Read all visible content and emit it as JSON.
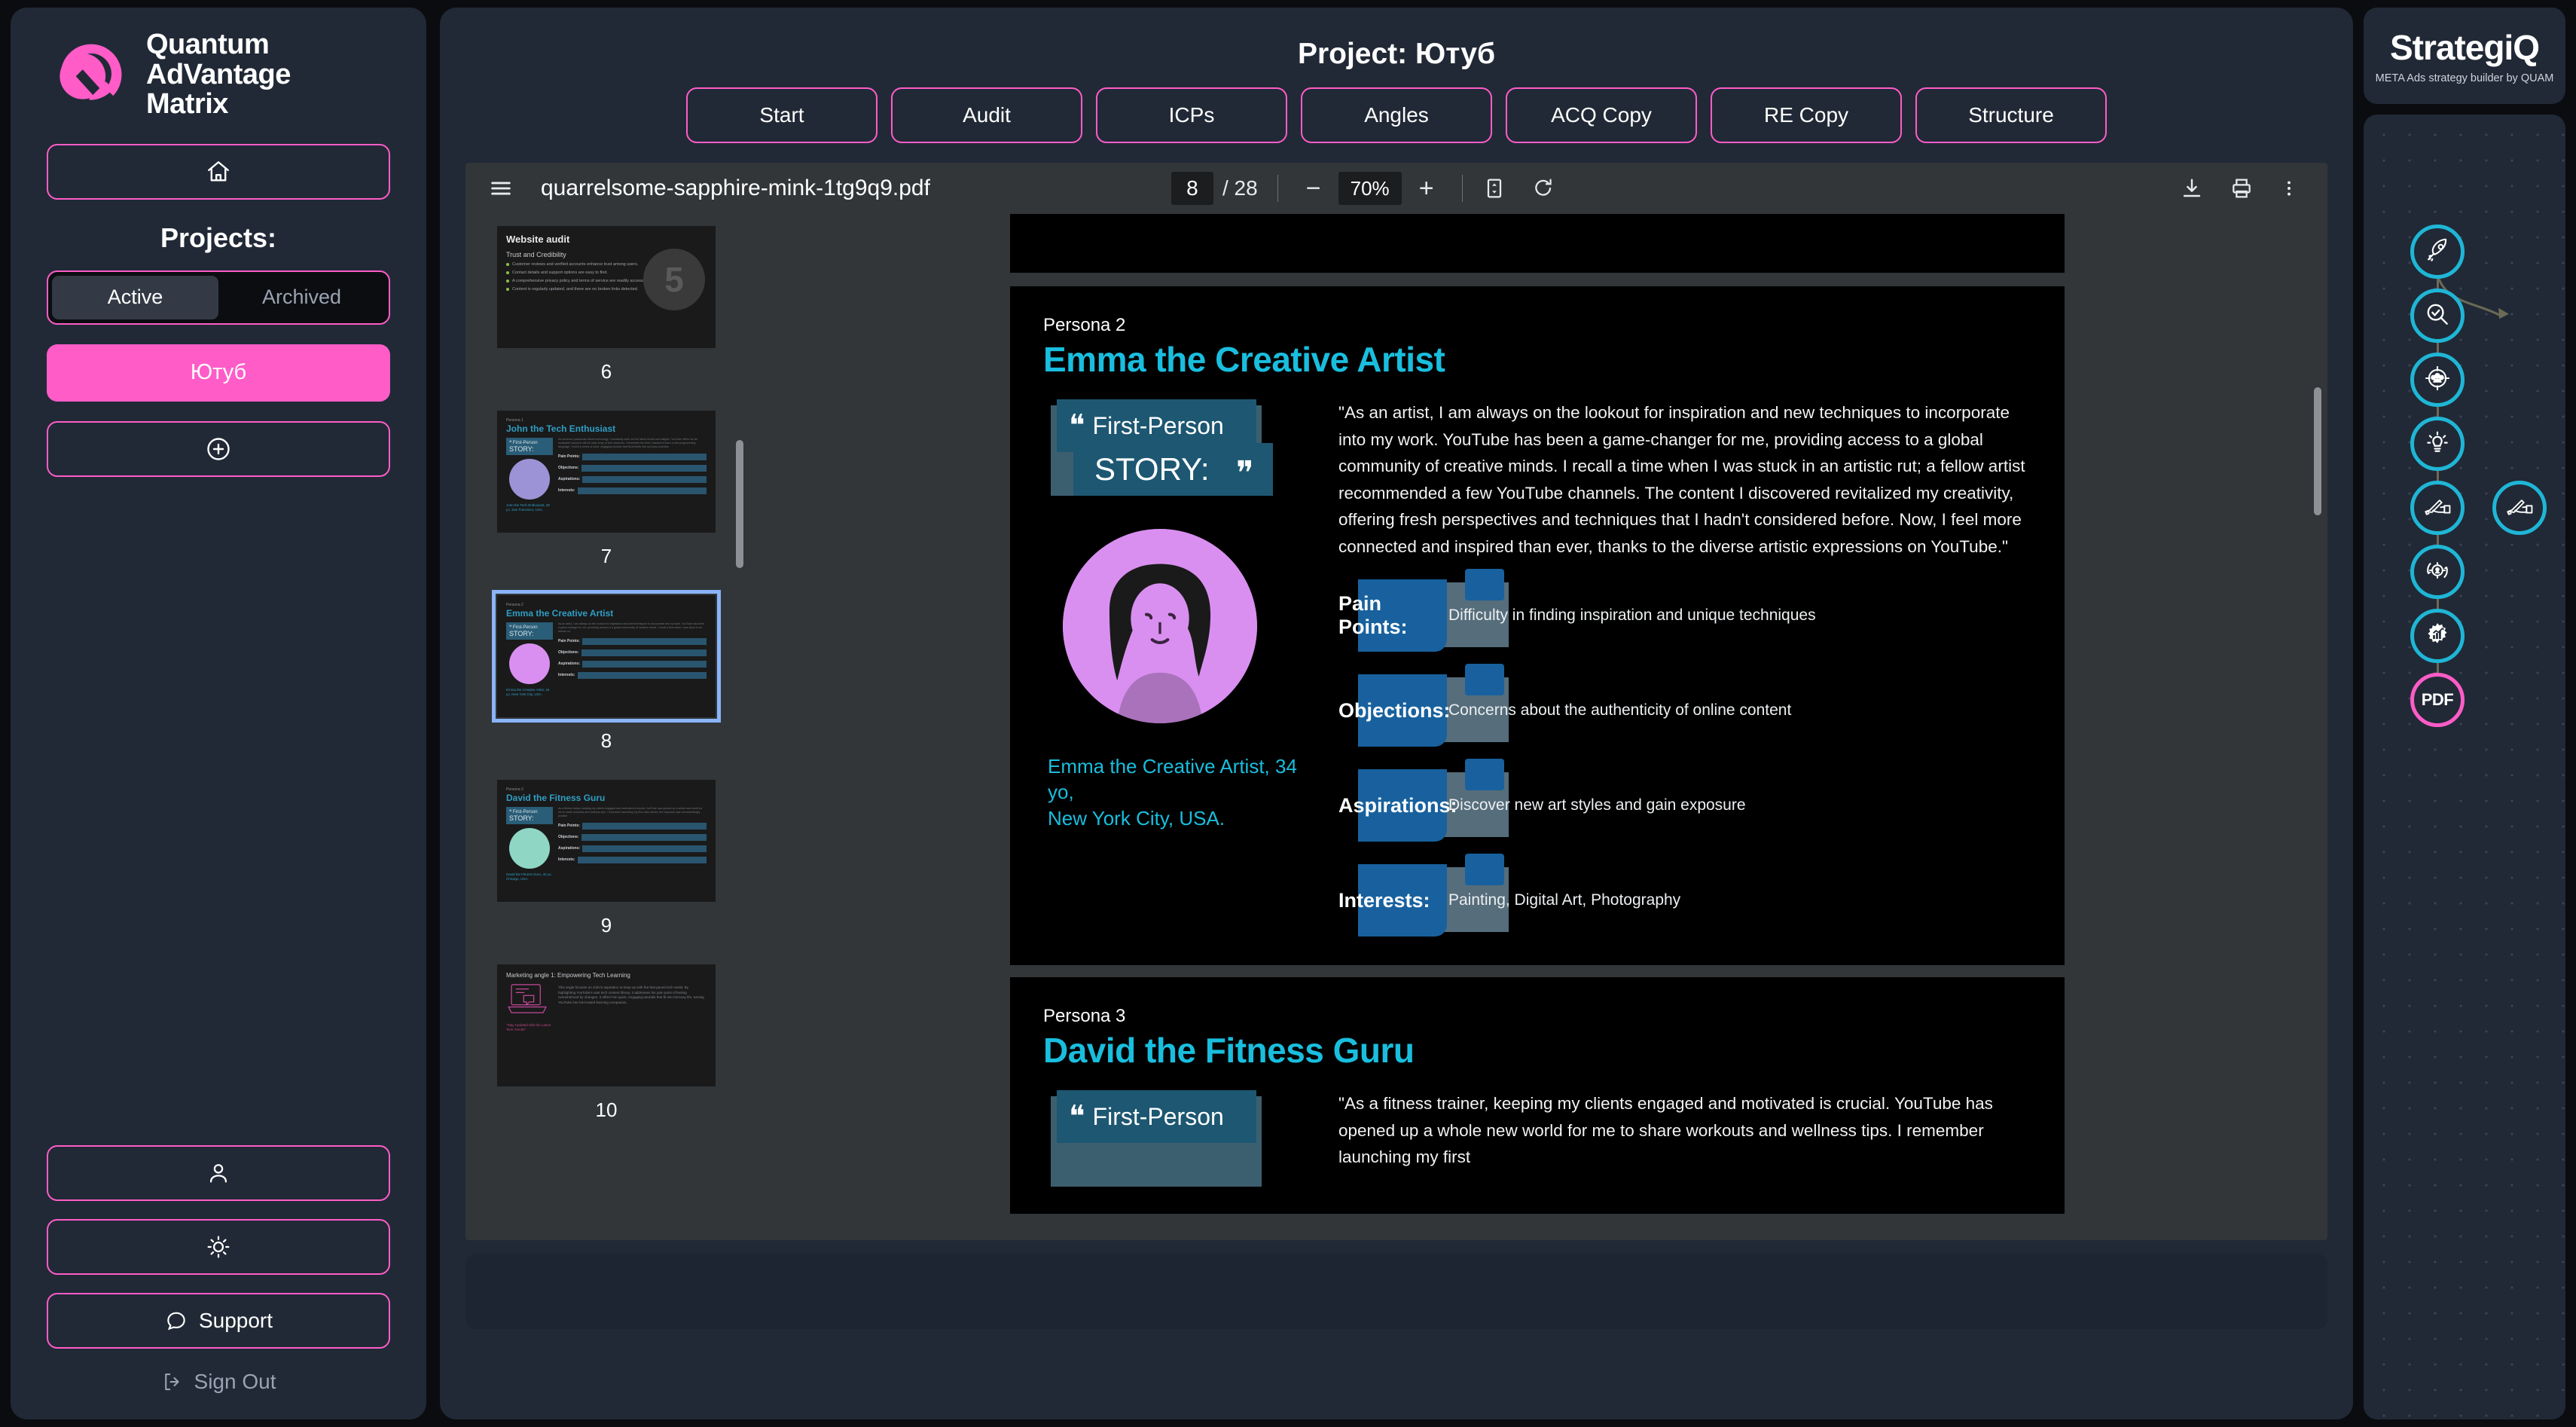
{
  "brand": {
    "name_line1": "Quantum",
    "name_line2": "AdVantage",
    "name_line3": "Matrix",
    "accent": "#ff5cc8"
  },
  "sidebar": {
    "home_icon": "home-icon",
    "projects_label": "Projects:",
    "filter": {
      "active": "Active",
      "archived": "Archived",
      "selected": "Active"
    },
    "projects": [
      {
        "label": "Ютуб",
        "selected": true
      }
    ],
    "add_project_icon": "plus-circle-icon",
    "account_icon": "user-icon",
    "theme_icon": "sun-icon",
    "support_label": "Support",
    "support_icon": "chat-bubble-icon",
    "signout_label": "Sign Out",
    "signout_icon": "logout-icon"
  },
  "center": {
    "project_title": "Project: Ютуб",
    "tabs": [
      {
        "label": "Start"
      },
      {
        "label": "Audit"
      },
      {
        "label": "ICPs"
      },
      {
        "label": "Angles"
      },
      {
        "label": "ACQ Copy"
      },
      {
        "label": "RE Copy"
      },
      {
        "label": "Structure"
      }
    ]
  },
  "pdf_toolbar": {
    "menu_icon": "hamburger-menu-icon",
    "filename": "quarrelsome-sapphire-mink-1tg9q9.pdf",
    "page_current": "8",
    "page_total": "/ 28",
    "zoom_out_icon": "minus-icon",
    "zoom_level": "70%",
    "zoom_in_icon": "plus-icon",
    "fit_icon": "fit-page-icon",
    "rotate_icon": "rotate-icon",
    "download_icon": "download-icon",
    "print_icon": "print-icon",
    "more_icon": "more-vertical-icon"
  },
  "thumbnails": [
    {
      "number": "6",
      "kind": "audit",
      "title": "Website audit",
      "subtitle": "Trust and Credibility",
      "badge": "5",
      "bullets": [
        "Customer reviews and verified accounts enhance trust among users.",
        "Contact details and support options are easy to find.",
        "A comprehensive privacy policy and terms of service are readily accessible.",
        "Content is regularly updated, and there are no broken links detected."
      ]
    },
    {
      "number": "7",
      "kind": "persona",
      "persona_label": "Persona 1",
      "persona_name": "John the Tech Enthusiast",
      "avatar_color": "#9b93d6",
      "caption": "John the Tech Enthusiast, 28 yo,\nSan Francisco, USA.",
      "fields": [
        "Pain Points:",
        "Objections:",
        "Aspirations:",
        "Interests:"
      ],
      "selected": false
    },
    {
      "number": "8",
      "kind": "persona",
      "persona_label": "Persona 2",
      "persona_name": "Emma the Creative Artist",
      "avatar_color": "#d98ff0",
      "caption": "Emma the Creative Artist, 34 yo,\nNew York City, USA.",
      "fields": [
        "Pain Points:",
        "Objections:",
        "Aspirations:",
        "Interests:"
      ],
      "selected": true
    },
    {
      "number": "9",
      "kind": "persona",
      "persona_label": "Persona 3",
      "persona_name": "David the Fitness Guru",
      "avatar_color": "#8fd6c5",
      "caption": "David the Fitness Guru, 40 yo,\nChicago, USA.",
      "fields": [
        "Pain Points:",
        "Objections:",
        "Aspirations:",
        "Interests:"
      ],
      "selected": false
    },
    {
      "number": "10",
      "kind": "angle",
      "title": "Marketing angle 1: Empowering Tech Learning",
      "body": "This angle focuses on John's aspiration to keep up with the fast-paced tech world. By highlighting YouTube's vast tech content library, it addresses his pain point of feeling overwhelmed by changes. It offers him quick, engaging tutorials that fit into his busy life, turning YouTube into his trusted learning companion.",
      "tagline": "\"Stay Updated with the Latest Tech Trends\""
    }
  ],
  "page": {
    "persona2": {
      "label": "Persona 2",
      "name": "Emma the Creative Artist",
      "quote_line1": "First-Person",
      "quote_line2": "STORY:",
      "story": "\"As an artist, I am always on the lookout for inspiration and new techniques to incorporate into my work. YouTube has been a game-changer for me, providing access to a global community of creative minds. I recall a time when I was stuck in an artistic rut; a fellow artist recommended a few YouTube channels. The content I discovered revitalized my creativity, offering fresh perspectives and techniques that I hadn't considered before. Now, I feel more connected and inspired than ever, thanks to the diverse artistic expressions on YouTube.\"",
      "caption_line1": "Emma the Creative Artist, 34 yo,",
      "caption_line2": "New York City, USA.",
      "fields": [
        {
          "label": "Pain Points:",
          "value": "Difficulty in finding inspiration and unique techniques"
        },
        {
          "label": "Objections:",
          "value": "Concerns about the authenticity of online content"
        },
        {
          "label": "Aspirations:",
          "value": "Discover new art styles and gain exposure"
        },
        {
          "label": "Interests:",
          "value": "Painting, Digital Art, Photography"
        }
      ]
    },
    "persona3": {
      "label": "Persona 3",
      "name": "David the Fitness Guru",
      "quote_line1": "First-Person",
      "story": "\"As a fitness trainer, keeping my clients engaged and motivated is crucial. YouTube has opened up a whole new world for me to share workouts and wellness tips. I remember launching my first"
    }
  },
  "right_panel": {
    "logo": "StrategiQ",
    "tagline": "META Ads strategy builder by QUAM",
    "flow_nodes": [
      {
        "name": "rocket-node",
        "icon": "rocket-icon",
        "color": "#1fb6d6"
      },
      {
        "name": "audit-node",
        "icon": "magnifier-check-icon",
        "color": "#1fb6d6"
      },
      {
        "name": "icp-node",
        "icon": "target-audience-icon",
        "color": "#1fb6d6"
      },
      {
        "name": "angles-node",
        "icon": "lightbulb-icon",
        "color": "#1fb6d6"
      },
      {
        "name": "acq-copy-node",
        "icon": "writing-hand-icon",
        "color": "#1fb6d6"
      },
      {
        "name": "re-copy-node",
        "icon": "writing-hand-icon",
        "color": "#1fb6d6"
      },
      {
        "name": "retention-node",
        "icon": "retargeting-icon",
        "color": "#1fb6d6"
      },
      {
        "name": "structure-node",
        "icon": "gear-chart-icon",
        "color": "#1fb6d6"
      },
      {
        "name": "pdf-node",
        "icon": "pdf-label",
        "label": "PDF",
        "color": "#ff5cc8"
      }
    ]
  }
}
